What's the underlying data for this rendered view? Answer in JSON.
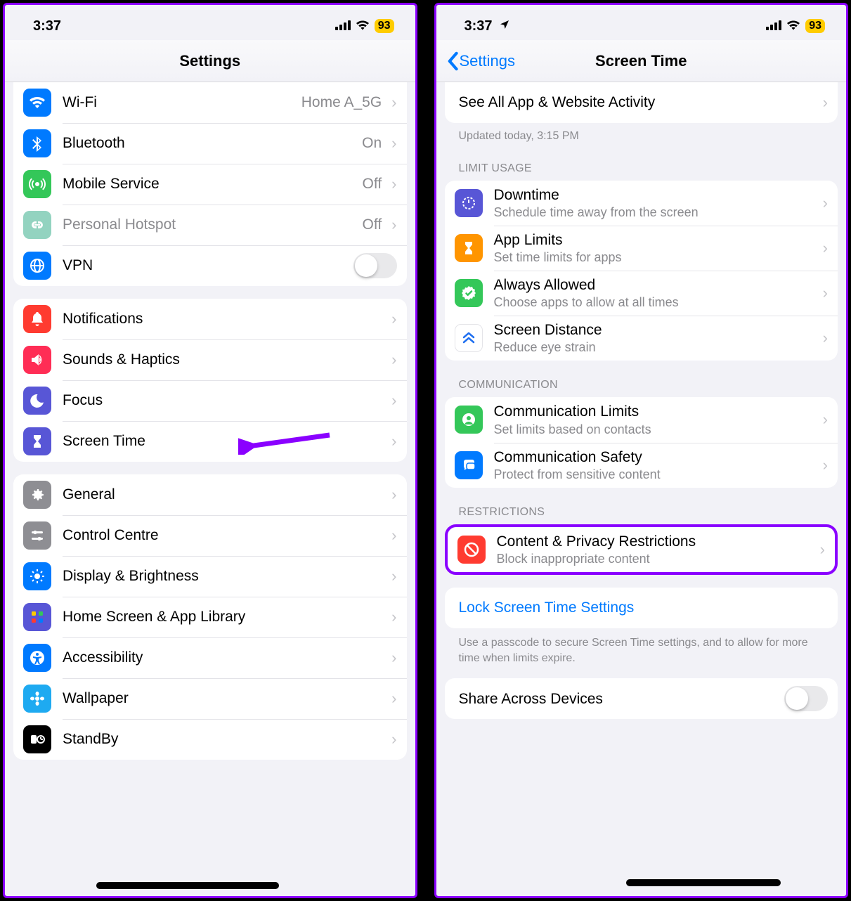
{
  "left": {
    "status": {
      "time": "3:37",
      "battery": "93"
    },
    "nav": {
      "title": "Settings"
    },
    "net": {
      "wifi": {
        "label": "Wi-Fi",
        "value": "Home A_5G"
      },
      "bt": {
        "label": "Bluetooth",
        "value": "On"
      },
      "cell": {
        "label": "Mobile Service",
        "value": "Off"
      },
      "hotspot": {
        "label": "Personal Hotspot",
        "value": "Off"
      },
      "vpn": {
        "label": "VPN"
      }
    },
    "mid": {
      "notif": {
        "label": "Notifications"
      },
      "sounds": {
        "label": "Sounds & Haptics"
      },
      "focus": {
        "label": "Focus"
      },
      "screentime": {
        "label": "Screen Time"
      }
    },
    "sys": {
      "general": {
        "label": "General"
      },
      "control": {
        "label": "Control Centre"
      },
      "display": {
        "label": "Display & Brightness"
      },
      "home": {
        "label": "Home Screen & App Library"
      },
      "access": {
        "label": "Accessibility"
      },
      "wall": {
        "label": "Wallpaper"
      },
      "standby": {
        "label": "StandBy"
      }
    }
  },
  "right": {
    "status": {
      "time": "3:37",
      "battery": "93"
    },
    "nav": {
      "back": "Settings",
      "title": "Screen Time"
    },
    "activity": {
      "label": "See All App & Website Activity",
      "updated": "Updated today, 3:15 PM"
    },
    "headers": {
      "limit": "LIMIT USAGE",
      "comm": "COMMUNICATION",
      "restrict": "RESTRICTIONS"
    },
    "limit": {
      "down": {
        "title": "Downtime",
        "sub": "Schedule time away from the screen"
      },
      "app": {
        "title": "App Limits",
        "sub": "Set time limits for apps"
      },
      "allow": {
        "title": "Always Allowed",
        "sub": "Choose apps to allow at all times"
      },
      "dist": {
        "title": "Screen Distance",
        "sub": "Reduce eye strain"
      }
    },
    "comm": {
      "limits": {
        "title": "Communication Limits",
        "sub": "Set limits based on contacts"
      },
      "safety": {
        "title": "Communication Safety",
        "sub": "Protect from sensitive content"
      }
    },
    "restrict": {
      "content": {
        "title": "Content & Privacy Restrictions",
        "sub": "Block inappropriate content"
      }
    },
    "lock": {
      "title": "Lock Screen Time Settings",
      "sub": "Use a passcode to secure Screen Time settings, and to allow for more time when limits expire."
    },
    "share": {
      "title": "Share Across Devices"
    }
  },
  "colors": {
    "blue": "#007aff",
    "green": "#34c759",
    "red": "#ff3b30",
    "orange": "#ff9500",
    "indigo": "#5856d6",
    "gray": "#8e8e93",
    "teal": "#93d3c0",
    "cyan": "#1eaaf1",
    "lightgray": "#a7a7ac"
  }
}
